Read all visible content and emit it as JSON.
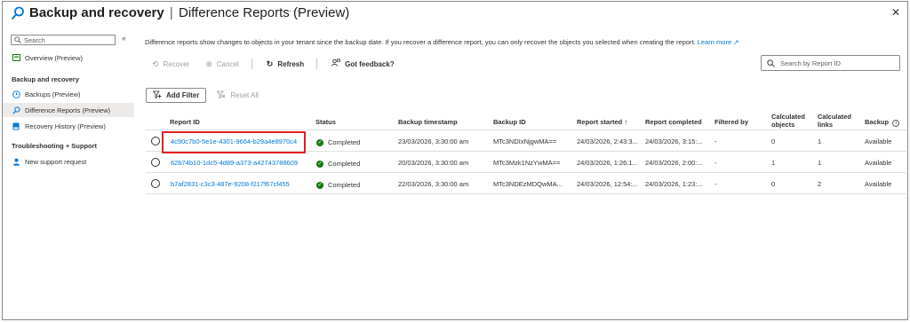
{
  "header": {
    "title_main": "Backup and recovery",
    "title_sep": "|",
    "title_sub": "Difference Reports (Preview)",
    "more": "···",
    "close": "✕"
  },
  "sidebar": {
    "search_placeholder": "Search",
    "collapse": "«",
    "items": [
      {
        "label": "Overview (Preview)",
        "icon": "overview-icon"
      },
      {
        "label": "Backups (Preview)",
        "icon": "clock-icon"
      },
      {
        "label": "Difference Reports (Preview)",
        "icon": "search-report-icon",
        "active": true
      },
      {
        "label": "Recovery History (Preview)",
        "icon": "history-icon"
      },
      {
        "label": "New support request",
        "icon": "person-icon"
      }
    ],
    "section_backup": "Backup and recovery",
    "section_troubleshooting": "Troubleshooting + Support"
  },
  "main": {
    "description": "Difference reports show changes to objects in your tenant since the backup date. If you recover a difference report, you can only recover the objects you selected when creating the report.",
    "learn_more": "Learn more",
    "toolbar": {
      "recover": "Recover",
      "cancel": "Cancel",
      "refresh": "Refresh",
      "feedback": "Got feedback?"
    },
    "search_placeholder": "Search by Report ID",
    "add_filter": "Add Filter",
    "reset_all": "Reset All",
    "columns": {
      "report_id": "Report ID",
      "status": "Status",
      "backup_timestamp": "Backup timestamp",
      "backup_id": "Backup ID",
      "report_started": "Report started ↑",
      "report_completed": "Report completed",
      "filtered_by": "Filtered by",
      "calc_objects_1": "Calculated",
      "calc_objects_2": "objects",
      "calc_links_1": "Calculated",
      "calc_links_2": "links",
      "backup": "Backup"
    },
    "rows": [
      {
        "report_id": "4c90c7b0-5e1e-4301-9664-b29a4e8970c4",
        "status": "Completed",
        "backup_timestamp": "23/03/2026, 3:30:00 am",
        "backup_id": "MTc3NDIxNjgwMA==",
        "report_started": "24/03/2026, 2:43:3...",
        "report_completed": "24/03/2026, 3:15:...",
        "filtered_by": "-",
        "calc_objects": "0",
        "calc_links": "1",
        "backup": "Available"
      },
      {
        "report_id": "62b74b10-1dc5-4d89-a373-a42743788609",
        "status": "Completed",
        "backup_timestamp": "20/03/2026, 3:30:00 am",
        "backup_id": "MTc3Mzk1NzYwMA==",
        "report_started": "24/03/2026, 1:26:1...",
        "report_completed": "24/03/2026, 2:00:...",
        "filtered_by": "-",
        "calc_objects": "1",
        "calc_links": "1",
        "backup": "Available"
      },
      {
        "report_id": "b7af2831-c3c3-487e-9208-f217f67cf455",
        "status": "Completed",
        "backup_timestamp": "22/03/2026, 3:30:00 am",
        "backup_id": "MTc3NDEzMDQwMA...",
        "report_started": "24/03/2026, 12:54:...",
        "report_completed": "24/03/2026, 1:23:...",
        "filtered_by": "-",
        "calc_objects": "0",
        "calc_links": "2",
        "backup": "Available"
      }
    ]
  },
  "colors": {
    "accent": "#0078d4",
    "success": "#107c10",
    "highlight": "#e02020",
    "active_nav": "#edebe9"
  }
}
